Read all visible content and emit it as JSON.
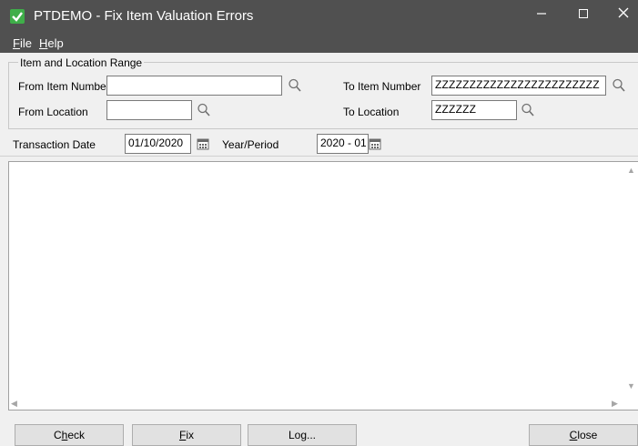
{
  "window": {
    "title": "PTDEMO - Fix Item Valuation Errors",
    "minimize_glyph": "–",
    "maximize_glyph": "☐",
    "close_glyph": "✕"
  },
  "menu": {
    "file": {
      "accel": "F",
      "rest": "ile"
    },
    "help": {
      "accel": "H",
      "rest": "elp"
    }
  },
  "range_group": {
    "title": "Item and Location Range",
    "from_item_label": "From Item Number",
    "from_item_value": "",
    "to_item_label": "To Item Number",
    "to_item_value": "ZZZZZZZZZZZZZZZZZZZZZZZZ",
    "from_location_label": "From Location",
    "from_location_value": "",
    "to_location_label": "To Location",
    "to_location_value": "ZZZZZZ"
  },
  "dates": {
    "transaction_date_label": "Transaction Date",
    "transaction_date_value": "01/10/2020",
    "year_period_label": "Year/Period",
    "year_period_value": "2020 - 01"
  },
  "buttons": {
    "check": {
      "accel": "h",
      "pre": "C",
      "post": "eck"
    },
    "fix": {
      "accel": "F",
      "pre": "",
      "post": "ix"
    },
    "log": {
      "label": "Log..."
    },
    "close": {
      "accel": "C",
      "pre": "",
      "post": "lose"
    }
  },
  "icons": {
    "app": "sage-checkmark-icon",
    "lookup": "magnifier-icon",
    "calendar": "calendar-icon"
  },
  "colors": {
    "titlebar": "#505050",
    "app_icon": "#3fae49"
  }
}
